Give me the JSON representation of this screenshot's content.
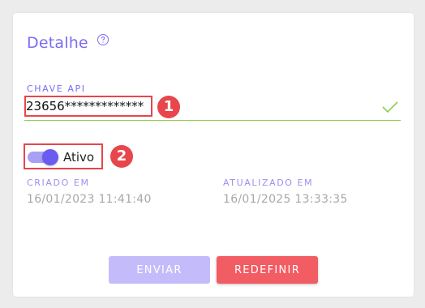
{
  "panel": {
    "title": "Detalhe",
    "help_icon": "help-circle-icon"
  },
  "api_key": {
    "label": "CHAVE API",
    "value": "23656*************",
    "status_icon": "check-icon",
    "valid": true
  },
  "annotations": [
    "1",
    "2"
  ],
  "status_toggle": {
    "label": "Ativo",
    "checked": true
  },
  "created": {
    "label": "CRIADO EM",
    "value": "16/01/2023 11:41:40"
  },
  "updated": {
    "label": "ATUALIZADO EM",
    "value": "16/01/2025 13:33:35"
  },
  "buttons": {
    "send": "ENVIAR",
    "reset": "REDEFINIR"
  },
  "colors": {
    "accent": "#7b6cf2",
    "valid": "#8ccf4a",
    "danger": "#f25c63",
    "disabled": "#c4bcfa"
  }
}
